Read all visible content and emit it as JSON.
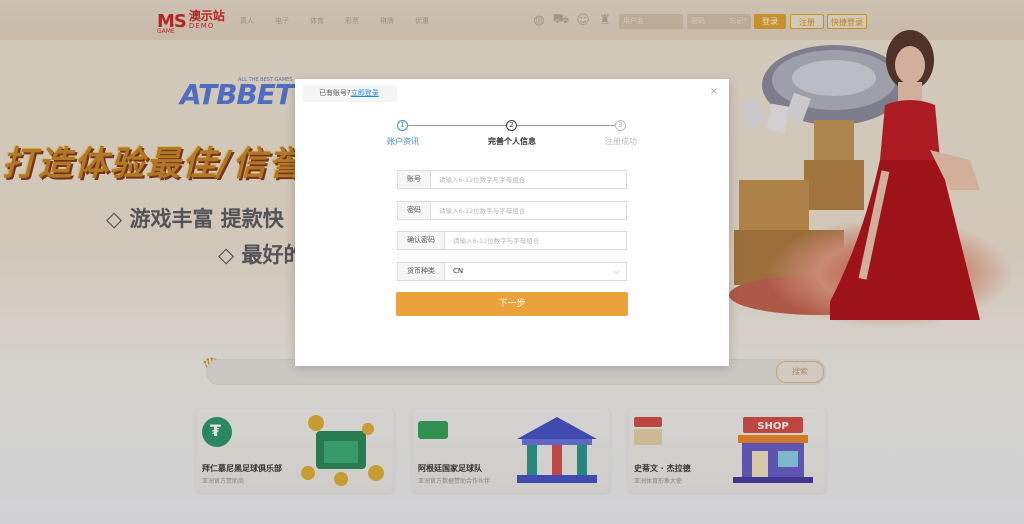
{
  "header": {
    "logo_ms": "MS",
    "logo_cn": "澳示站",
    "logo_demo": "DEMO",
    "logo_game": "GAME",
    "nav": [
      "真人",
      "电子",
      "体育",
      "彩票",
      "棋牌",
      "优惠"
    ],
    "icons": [
      "globe-icon",
      "car-icon",
      "user-support-icon",
      "shirt-icon"
    ],
    "username_placeholder": "用户名",
    "password_placeholder": "密码",
    "forgot_label": "忘记?",
    "login_label": "登录",
    "register_label": "注册",
    "quick_login_label": "快捷登录"
  },
  "hero": {
    "brand": "ATBBET",
    "brand_tag": "ALL THE BEST GAMES",
    "headline": "打造体验最佳/信誉",
    "sub1": "◇ 游戏丰富  提款快",
    "sub2": "◇ 最好的"
  },
  "search": {
    "button_label": "搜索"
  },
  "cards": [
    {
      "title": "拜仁慕尼黑足球俱乐部",
      "subtitle": "亚洲官方赞助商",
      "color": "#2f9b6f"
    },
    {
      "title": "阿根廷国家足球队",
      "subtitle": "亚洲官方数据赞助合作伙伴",
      "color": "#3aa35c"
    },
    {
      "title": "史蒂文 · 杰拉德",
      "subtitle": "亚洲体育形象大使",
      "color": "#d8504a"
    }
  ],
  "modal": {
    "login_prompt": "已有账号?",
    "login_link": "立即登录",
    "close": "×",
    "steps": [
      {
        "num": "1",
        "label": "账户资讯",
        "state": "done"
      },
      {
        "num": "2",
        "label": "完善个人信息",
        "state": "active"
      },
      {
        "num": "3",
        "label": "注册成功",
        "state": "pending"
      }
    ],
    "fields": {
      "account": {
        "label": "账号",
        "placeholder": "请输入6-12位数字与字母组合"
      },
      "password": {
        "label": "密码",
        "placeholder": "请输入6-12位数字与字母组合"
      },
      "confirm": {
        "label": "确认密码",
        "placeholder": "请输入6-12位数字与字母组合"
      },
      "currency": {
        "label": "货币种类",
        "value": "CN"
      }
    },
    "next_label": "下一步"
  },
  "colors": {
    "accent": "#e9a33a",
    "link": "#1e88e5",
    "step_done": "#3b8fd9"
  }
}
